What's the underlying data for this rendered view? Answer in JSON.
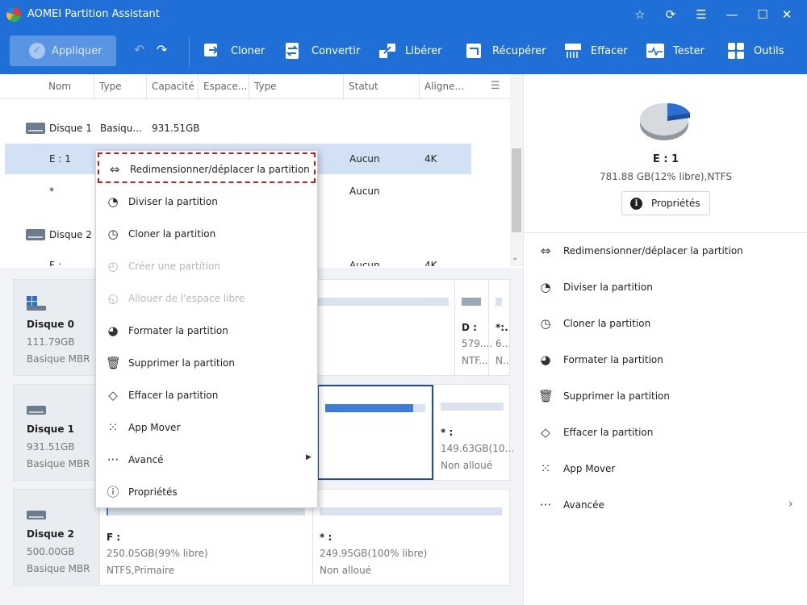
{
  "app": {
    "title": "AOMEI Partition Assistant"
  },
  "toolbar": {
    "apply": "Appliquer",
    "items": [
      {
        "label": "Cloner",
        "icon": "clone-icon"
      },
      {
        "label": "Convertir",
        "icon": "convert-icon"
      },
      {
        "label": "Libérer",
        "icon": "free-up-icon"
      },
      {
        "label": "Récupérer",
        "icon": "recover-icon"
      },
      {
        "label": "Effacer",
        "icon": "wipe-icon"
      },
      {
        "label": "Tester",
        "icon": "test-icon"
      },
      {
        "label": "Outils",
        "icon": "tools-icon"
      }
    ]
  },
  "columns": [
    "Nom",
    "Type",
    "Capacité",
    "Espace...",
    "Type",
    "Statut",
    "Aligne..."
  ],
  "disk_list": {
    "disk1": {
      "name": "Disque 1",
      "type": "Basiqu...",
      "capacity": "931.51GB"
    },
    "e_row": {
      "name": "E : 1",
      "status": "Aucun",
      "align": "4K"
    },
    "star_row": {
      "name": "*",
      "status": "Aucun"
    },
    "disk2": {
      "name": "Disque 2"
    },
    "f_row": {
      "name": "F :",
      "status": "Aucun",
      "align": "4K"
    }
  },
  "disks": [
    {
      "name": "Disque 0",
      "size": "111.79GB",
      "type": "Basique MBR",
      "partitions": [
        {
          "label": "D :",
          "size": "579....",
          "fs": "NTF..."
        },
        {
          "label": "*:...",
          "size": "6...",
          "fs": "N..."
        }
      ]
    },
    {
      "name": "Disque 1",
      "size": "931.51GB",
      "type": "Basique MBR",
      "partitions": [
        {
          "label": "* :",
          "size": "149.63GB(10...",
          "fs": "Non alloué"
        }
      ]
    },
    {
      "name": "Disque 2",
      "size": "500.00GB",
      "type": "Basique MBR",
      "partitions": [
        {
          "label": "F :",
          "size": "250.05GB(99% libre)",
          "fs": "NTFS,Primaire"
        },
        {
          "label": "* :",
          "size": "249.95GB(100% libre)",
          "fs": "Non alloué"
        }
      ]
    }
  ],
  "context_menu": [
    {
      "label": "Redimensionner/déplacer la partition",
      "icon": "resize-icon",
      "enabled": true
    },
    {
      "label": "Diviser la partition",
      "icon": "split-icon",
      "enabled": true
    },
    {
      "label": "Cloner la partition",
      "icon": "clone-partition-icon",
      "enabled": true
    },
    {
      "label": "Créer une partition",
      "icon": "create-partition-icon",
      "enabled": false
    },
    {
      "label": "Allouer de l'espace libre",
      "icon": "allocate-icon",
      "enabled": false
    },
    {
      "label": "Formater la partition",
      "icon": "format-icon",
      "enabled": true
    },
    {
      "label": "Supprimer la partition",
      "icon": "delete-icon",
      "enabled": true
    },
    {
      "label": "Effacer la partition",
      "icon": "wipe-partition-icon",
      "enabled": true
    },
    {
      "label": "App Mover",
      "icon": "app-mover-icon",
      "enabled": true
    },
    {
      "label": "Avancé",
      "icon": "more-icon",
      "enabled": true
    },
    {
      "label": "Propriétés",
      "icon": "info-icon",
      "enabled": true
    }
  ],
  "right_panel": {
    "partition": "E : 1",
    "info": "781.88 GB(12% libre),NTFS",
    "properties_btn": "Propriétés",
    "used_fraction": 0.88,
    "actions": [
      {
        "label": "Redimensionner/déplacer la partition",
        "icon": "resize-icon"
      },
      {
        "label": "Diviser la partition",
        "icon": "split-icon"
      },
      {
        "label": "Cloner la partition",
        "icon": "clone-partition-icon"
      },
      {
        "label": "Formater la partition",
        "icon": "format-icon"
      },
      {
        "label": "Supprimer la partition",
        "icon": "delete-icon"
      },
      {
        "label": "Effacer la partition",
        "icon": "wipe-partition-icon"
      },
      {
        "label": "App Mover",
        "icon": "app-mover-icon"
      },
      {
        "label": "Avancée",
        "icon": "more-icon"
      }
    ]
  },
  "usage": {
    "d0_bar": 0.02,
    "d1_selected_bar": 0.88,
    "d2_f_bar": 0.01
  },
  "colors": {
    "accent": "#1f6fd6",
    "highlight_border": "#d11a1a",
    "selected_row": "#d3e1f4"
  }
}
